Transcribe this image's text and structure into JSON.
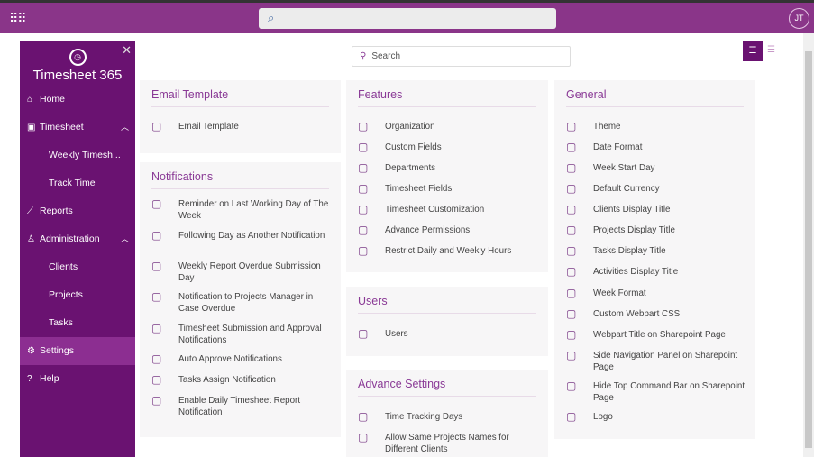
{
  "topbar": {
    "avatar": "JT"
  },
  "app": {
    "title": "Timesheet 365"
  },
  "sidebar": [
    {
      "label": "Home",
      "icon": "⌂"
    },
    {
      "label": "Timesheet",
      "icon": "▣",
      "chev": "^"
    },
    {
      "label": "Weekly Timesh...",
      "sub": true
    },
    {
      "label": "Track Time",
      "sub": true
    },
    {
      "label": "Reports",
      "icon": "⟋"
    },
    {
      "label": "Administration",
      "icon": "♙",
      "chev": "^"
    },
    {
      "label": "Clients",
      "sub": true
    },
    {
      "label": "Projects",
      "sub": true
    },
    {
      "label": "Tasks",
      "sub": true
    },
    {
      "label": "Settings",
      "icon": "⚙",
      "selected": true
    },
    {
      "label": "Help",
      "icon": "?"
    }
  ],
  "search": {
    "placeholder": "Search"
  },
  "cards": [
    {
      "title": "Email Template",
      "items": [
        "Email Template"
      ]
    },
    {
      "title": "Notifications",
      "items": [
        "Reminder on Last Working Day of The Week",
        "Following Day as Another Notification",
        "Weekly Report Overdue Submission Day",
        "Notification to Projects Manager in Case Overdue",
        "Timesheet Submission and Approval Notifications",
        "Auto Approve Notifications",
        "Tasks Assign Notification",
        "Enable Daily Timesheet Report Notification"
      ]
    },
    {
      "title": "Features",
      "items": [
        "Organization",
        "Custom Fields",
        "Departments",
        "Timesheet Fields",
        "Timesheet Customization",
        "Advance Permissions",
        "Restrict Daily and Weekly Hours"
      ]
    },
    {
      "title": "Users",
      "items": [
        "Users"
      ]
    },
    {
      "title": "Advance Settings",
      "items": [
        "Time Tracking Days",
        "Allow Same Projects Names for Different Clients"
      ]
    },
    {
      "title": "General",
      "items": [
        "Theme",
        "Date Format",
        "Week Start Day",
        "Default Currency",
        "Clients Display Title",
        "Projects Display Title",
        "Tasks Display Title",
        "Activities Display Title",
        "Week Format",
        "Custom Webpart CSS",
        "Webpart Title on Sharepoint Page",
        "Side Navigation Panel on Sharepoint Page",
        "Hide Top Command Bar on Sharepoint Page",
        "Logo"
      ]
    }
  ]
}
